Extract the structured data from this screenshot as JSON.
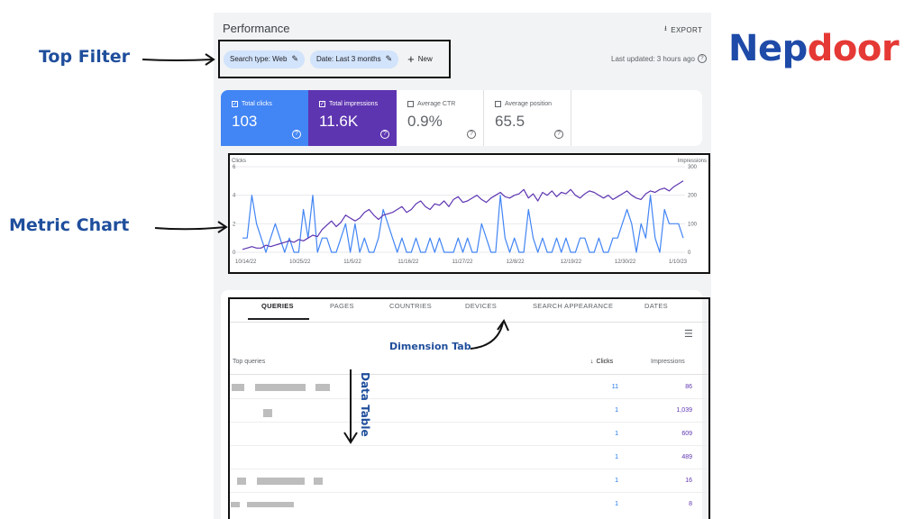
{
  "header": {
    "title": "Performance",
    "export_label": "EXPORT",
    "last_updated": "Last updated: 3 hours ago"
  },
  "filters": {
    "chips": [
      "Search type: Web",
      "Date: Last 3 months"
    ],
    "new_label": "New"
  },
  "metrics": [
    {
      "label": "Total clicks",
      "value": "103",
      "checked": true
    },
    {
      "label": "Total impressions",
      "value": "11.6K",
      "checked": true
    },
    {
      "label": "Average CTR",
      "value": "0.9%",
      "checked": false
    },
    {
      "label": "Average position",
      "value": "65.5",
      "checked": false
    }
  ],
  "chart_data": {
    "type": "line",
    "ylabel_left": "Clicks",
    "ylabel_right": "Impressions",
    "y_left_ticks": [
      "0",
      "2",
      "4",
      "6"
    ],
    "y_right_ticks": [
      "0",
      "100",
      "200",
      "300"
    ],
    "x_ticks": [
      "10/14/22",
      "10/25/22",
      "11/5/22",
      "11/16/22",
      "11/27/22",
      "12/8/22",
      "12/19/22",
      "12/30/22",
      "1/10/23"
    ],
    "ylim_left": [
      0,
      6
    ],
    "ylim_right": [
      0,
      300
    ],
    "series": [
      {
        "name": "Clicks",
        "axis": "left",
        "color": "#4285f4",
        "values": [
          1,
          1,
          4,
          2,
          1,
          0,
          1,
          2,
          1,
          0,
          1,
          0,
          0,
          3,
          1,
          4,
          0,
          1,
          1,
          0,
          0,
          1,
          2,
          0,
          2,
          0,
          1,
          0,
          0,
          1,
          3,
          2,
          1,
          0,
          1,
          0,
          0,
          1,
          0,
          0,
          1,
          0,
          1,
          0,
          0,
          0,
          1,
          0,
          1,
          0,
          0,
          2,
          1,
          0,
          0,
          4,
          1,
          0,
          1,
          0,
          0,
          3,
          1,
          0,
          1,
          0,
          0,
          1,
          0,
          1,
          0,
          0,
          1,
          1,
          0,
          0,
          1,
          0,
          0,
          1,
          1,
          2,
          3,
          2,
          0,
          2,
          1,
          4,
          1,
          0,
          3,
          2,
          2,
          2,
          1
        ]
      },
      {
        "name": "Impressions",
        "axis": "right",
        "color": "#5e35b1",
        "values": [
          10,
          15,
          20,
          15,
          15,
          25,
          20,
          25,
          30,
          35,
          40,
          35,
          45,
          40,
          50,
          60,
          55,
          80,
          95,
          110,
          90,
          105,
          130,
          120,
          110,
          120,
          140,
          150,
          130,
          115,
          130,
          135,
          140,
          150,
          160,
          140,
          150,
          170,
          180,
          160,
          150,
          170,
          165,
          180,
          160,
          185,
          195,
          175,
          180,
          190,
          200,
          185,
          175,
          190,
          200,
          210,
          195,
          190,
          200,
          205,
          220,
          190,
          205,
          180,
          210,
          200,
          215,
          195,
          210,
          205,
          220,
          200,
          190,
          205,
          215,
          210,
          200,
          190,
          200,
          185,
          195,
          205,
          215,
          200,
          190,
          185,
          205,
          215,
          210,
          220,
          225,
          215,
          230,
          240,
          250
        ]
      }
    ]
  },
  "tabs": [
    "QUERIES",
    "PAGES",
    "COUNTRIES",
    "DEVICES",
    "SEARCH APPEARANCE",
    "DATES"
  ],
  "table": {
    "col_query": "Top queries",
    "col_clicks": "Clicks",
    "col_impressions": "Impressions",
    "rows": [
      {
        "clicks": "11",
        "impressions": "86"
      },
      {
        "clicks": "1",
        "impressions": "1,039"
      },
      {
        "clicks": "1",
        "impressions": "609"
      },
      {
        "clicks": "1",
        "impressions": "489"
      },
      {
        "clicks": "1",
        "impressions": "16"
      },
      {
        "clicks": "1",
        "impressions": "8"
      }
    ]
  },
  "annotations": {
    "top_filter": "Top Filter",
    "metric_chart": "Metric Chart",
    "dimension_tab": "Dimension Tab",
    "data_table": "Data Table"
  },
  "brand": {
    "part1": "Nep",
    "part2": "door"
  }
}
